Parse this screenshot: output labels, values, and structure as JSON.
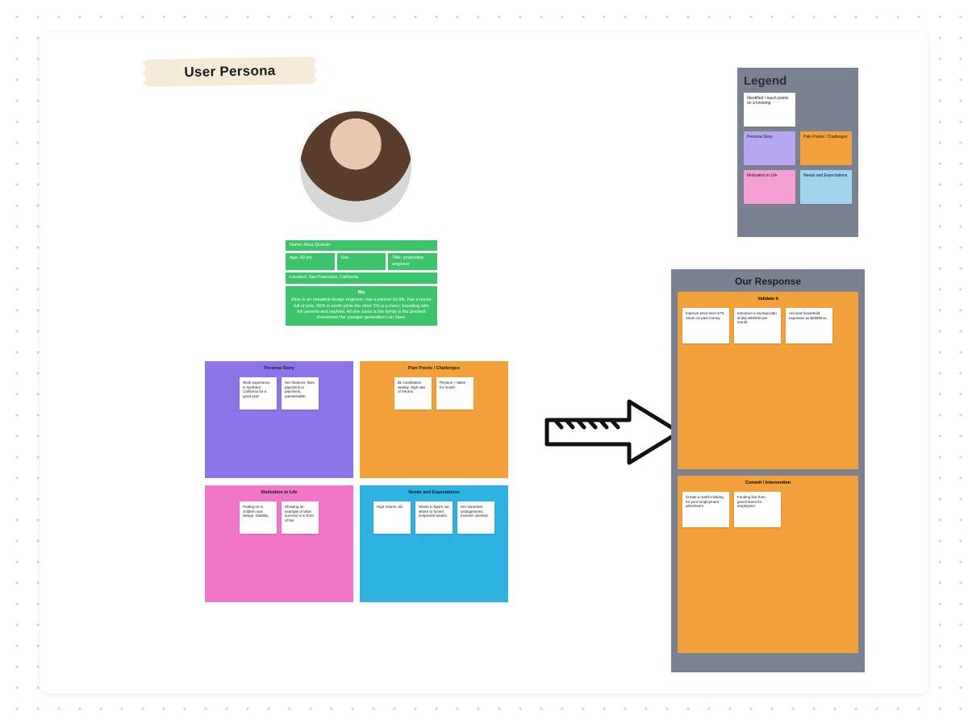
{
  "title": "User Persona",
  "info": {
    "name_line": "Name: Alisa Quando",
    "age": "Age: 43 yrs",
    "sex": "Sex",
    "title": "Title: production engineer",
    "location": "Location: San Francisco, California",
    "bio_heading": "Bio",
    "bio": "Alisa is an industrial design engineer, has a partner for life, has a house full of pets, 95% is worth while the other 5% is a mess, travelling with the parents and nephew. All she cares is the family is the greatest investment the younger generation can have."
  },
  "quadrants": {
    "persona": {
      "heading": "Persona Story",
      "notes": [
        "Work experience in Northern California for a good year.",
        "Her finances: lives paycheck to paycheck, questionable."
      ]
    },
    "pain": {
      "heading": "Pain Points / Challenges",
      "notes": [
        "$1 contribution weekly. High rate of returns.",
        "Pension + taken for month."
      ]
    },
    "motivation": {
      "heading": "Motivation in Life",
      "notes": [
        "Putting on to children and design. Stability.",
        "Showing an example of what success is in front of her."
      ]
    },
    "needs": {
      "heading": "Needs and Expectations",
      "notes": [
        "High returns, all.",
        "Wants to figure out where to funnel suspected assets.",
        "Her important arrangements. Investor oriented."
      ]
    }
  },
  "arrow_label": "arrow",
  "legend": {
    "heading": "Legend",
    "items": [
      {
        "label": "Identified / touch points on a knowing",
        "color": "white",
        "span": 1
      },
      {
        "label": "Persona Story",
        "color": "purple",
        "span": 0
      },
      {
        "label": "Pain Points / Challenges",
        "color": "orange",
        "span": 0
      },
      {
        "label": "Motivation in Life",
        "color": "pink",
        "span": 0
      },
      {
        "label": "Needs and Expectations",
        "color": "blue",
        "span": 0
      }
    ]
  },
  "response": {
    "heading": "Our Response",
    "sections": [
      {
        "heading": "Validate it",
        "notes": [
          "Improve price level 47% return on past money.",
          "Introduce a savings plan at $11,500/830 per month.",
          "Account household expenses as $2559/mo."
        ]
      },
      {
        "heading": "Commit / Intervention",
        "notes": [
          "Create a match-making for your employment advertisers.",
          "Funding line from government for employees."
        ]
      }
    ]
  }
}
